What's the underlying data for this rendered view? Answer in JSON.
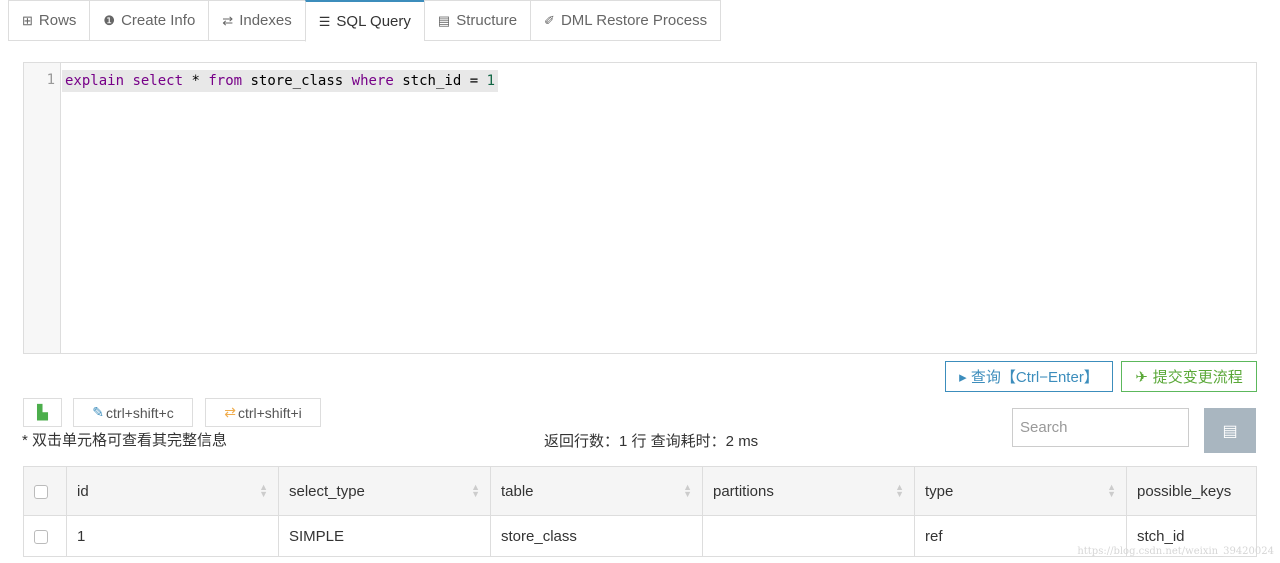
{
  "tabs": [
    {
      "label": "Rows",
      "icon": "grid-icon"
    },
    {
      "label": "Create Info",
      "icon": "info-icon"
    },
    {
      "label": "Indexes",
      "icon": "swap-icon"
    },
    {
      "label": "SQL Query",
      "icon": "database-icon",
      "active": true
    },
    {
      "label": "Structure",
      "icon": "structure-icon"
    },
    {
      "label": "DML Restore Process",
      "icon": "plug-icon"
    }
  ],
  "editor": {
    "line_number": "1",
    "tokens": [
      "explain",
      "select",
      "*",
      "from",
      "store_class",
      "where",
      "stch_id",
      "=",
      "1"
    ]
  },
  "buttons": {
    "query": "▸ 查询【Ctrl−Enter】",
    "submit": "提交变更流程",
    "copy_shortcut": "ctrl+shift+c",
    "swap_shortcut": "ctrl+shift+i"
  },
  "hint": "* 双击单元格可查看其完整信息",
  "stats": "返回行数：1 行  查询耗时：2 ms",
  "search": {
    "placeholder": "Search",
    "value": ""
  },
  "table": {
    "headers": [
      "id",
      "select_type",
      "table",
      "partitions",
      "type",
      "possible_keys"
    ],
    "rows": [
      [
        "1",
        "SIMPLE",
        "store_class",
        "",
        "ref",
        "stch_id"
      ]
    ]
  },
  "watermark": "https://blog.csdn.net/weixin_39420024",
  "colors": {
    "accent": "#3c8dbc",
    "success": "#5cb85c",
    "keyword": "#770088",
    "number": "#116644"
  }
}
